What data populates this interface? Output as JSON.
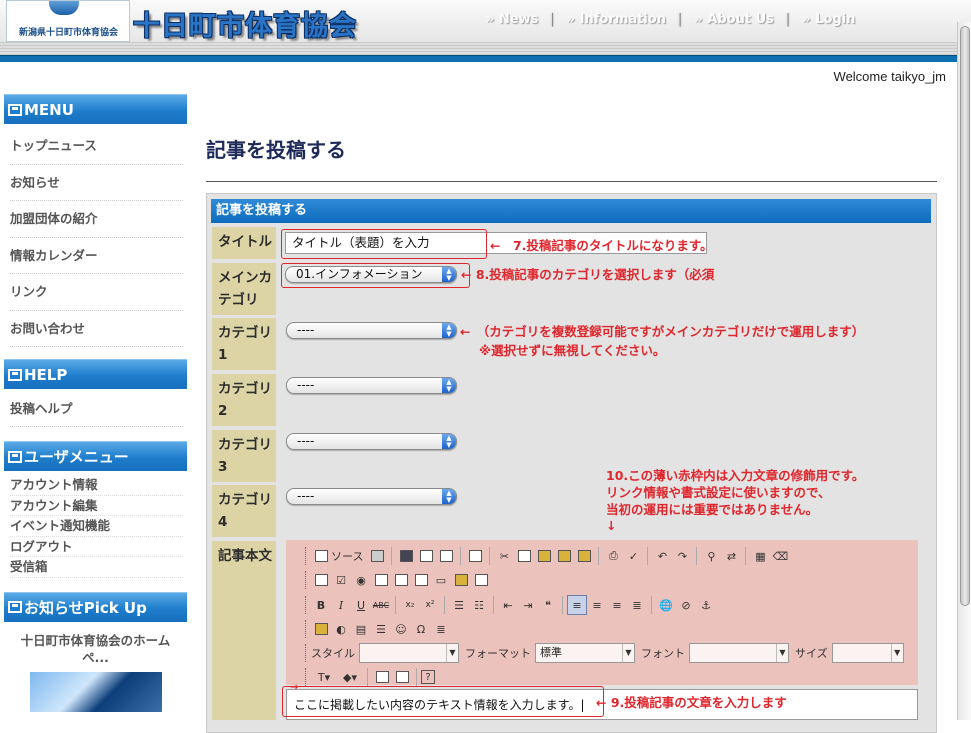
{
  "header": {
    "org_sub": "新潟県十日町市体育協会",
    "site_title": "十日町市体育協会",
    "nav": [
      "» News",
      "» Information",
      "» About Us",
      "» Login"
    ]
  },
  "welcome": "Welcome taikyo_jm",
  "sidebar": {
    "menu": {
      "title": "MENU",
      "items": [
        "トップニュース",
        "お知らせ",
        "加盟団体の紹介",
        "情報カレンダー",
        "リンク",
        "お問い合わせ"
      ]
    },
    "help": {
      "title": "HELP",
      "items": [
        "投稿ヘルプ"
      ]
    },
    "user": {
      "title": "ユーザメニュー",
      "items": [
        "アカウント情報",
        "アカウント編集",
        "イベント通知機能",
        "ログアウト",
        "受信箱"
      ]
    },
    "pickup": {
      "title": "お知らせPick Up",
      "item_title": "十日町市体育協会のホームペ..."
    }
  },
  "main": {
    "page_title": "記事を投稿する",
    "panel_title": "記事を投稿する",
    "labels": {
      "title": "タイトル",
      "main_cat_1": "メインカ",
      "main_cat_2": "テゴリ",
      "cat1_a": "カテゴリ",
      "cat1_b": "1",
      "cat2_a": "カテゴリ",
      "cat2_b": "2",
      "cat3_a": "カテゴリ",
      "cat3_b": "3",
      "cat4_a": "カテゴリ",
      "cat4_b": "4",
      "body": "記事本文"
    },
    "title_value": "タイトル（表題）を入力",
    "main_category_value": "01.インフォメーション",
    "category_placeholder": "----",
    "editor": {
      "source_label": "ソース",
      "style_label": "スタイル",
      "format_label": "フォーマット",
      "format_value": "標準",
      "font_label": "フォント",
      "size_label": "サイズ"
    },
    "content_value": "ここに掲載したい内容のテキスト情報を入力します。|"
  },
  "annotations": {
    "a7": "←　7.投稿記事のタイトルになります。",
    "a8": "← 8.投稿記事のカテゴリを選択します（必須",
    "a_cat_1": "←　（カテゴリを複数登録可能ですがメインカテゴリだけで運用します）",
    "a_cat_2": "※選択せずに無視してください。",
    "a10_1": "10.この薄い赤枠内は入力文章の修飾用です。",
    "a10_2": "リンク情報や書式設定に使いますので、",
    "a10_3": "当初の運用には重要ではありません。",
    "a10_arrow": "↓",
    "a9": "← 9.投稿記事の文章を入力します",
    "a9_left_arrow": "→"
  },
  "colors": {
    "accent_blue": "#1e7dcc",
    "annotation_red": "#e0262d",
    "editor_pink": "#ebc2bc",
    "label_khaki": "#ddd4a6"
  }
}
